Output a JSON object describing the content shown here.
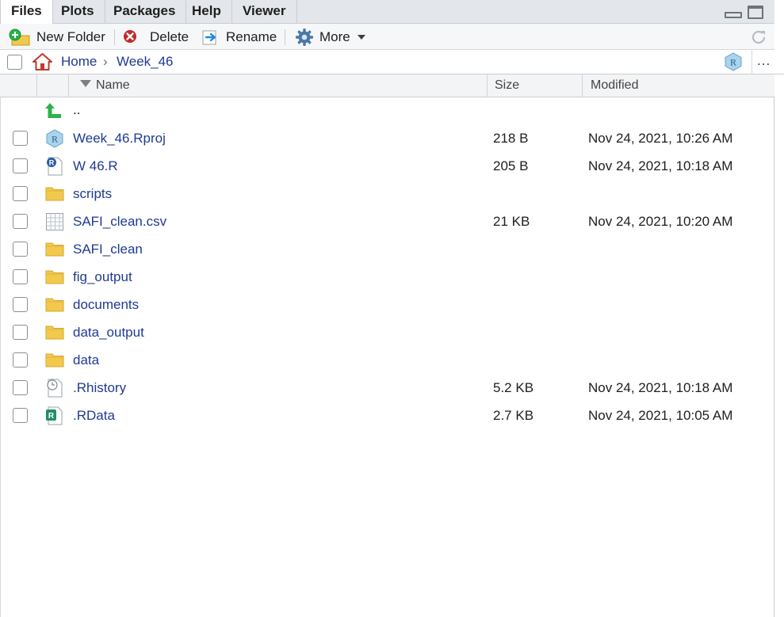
{
  "tabs": [
    {
      "label": "Files",
      "active": true
    },
    {
      "label": "Plots",
      "active": false
    },
    {
      "label": "Packages",
      "active": false
    },
    {
      "label": "Help",
      "active": false
    },
    {
      "label": "Viewer",
      "active": false
    }
  ],
  "toolbar": {
    "new_folder": "New Folder",
    "delete": "Delete",
    "rename": "Rename",
    "more": "More"
  },
  "breadcrumb": {
    "home": "Home",
    "separator": "›",
    "current": "Week_46",
    "overflow": "..."
  },
  "columns": {
    "name": "Name",
    "size": "Size",
    "modified": "Modified"
  },
  "updir_label": "..",
  "files": [
    {
      "name": "Week_46.Rproj",
      "size": "218 B",
      "modified": "Nov 24, 2021, 10:26 AM",
      "icon": "rproj-icon"
    },
    {
      "name": "W 46.R",
      "size": "205 B",
      "modified": "Nov 24, 2021, 10:18 AM",
      "icon": "r-script-icon"
    },
    {
      "name": "scripts",
      "size": "",
      "modified": "",
      "icon": "folder-icon"
    },
    {
      "name": "SAFI_clean.csv",
      "size": "21 KB",
      "modified": "Nov 24, 2021, 10:20 AM",
      "icon": "csv-file-icon"
    },
    {
      "name": "SAFI_clean",
      "size": "",
      "modified": "",
      "icon": "folder-icon"
    },
    {
      "name": "fig_output",
      "size": "",
      "modified": "",
      "icon": "folder-icon"
    },
    {
      "name": "documents",
      "size": "",
      "modified": "",
      "icon": "folder-icon"
    },
    {
      "name": "data_output",
      "size": "",
      "modified": "",
      "icon": "folder-icon"
    },
    {
      "name": "data",
      "size": "",
      "modified": "",
      "icon": "folder-icon"
    },
    {
      "name": ".Rhistory",
      "size": "5.2 KB",
      "modified": "Nov 24, 2021, 10:18 AM",
      "icon": "rhistory-icon"
    },
    {
      "name": ".RData",
      "size": "2.7 KB",
      "modified": "Nov 24, 2021, 10:05 AM",
      "icon": "rdata-icon"
    }
  ],
  "colors": {
    "link": "#1f3a93",
    "folder": "#f2c94c",
    "updir_arrow": "#2bb24c"
  }
}
